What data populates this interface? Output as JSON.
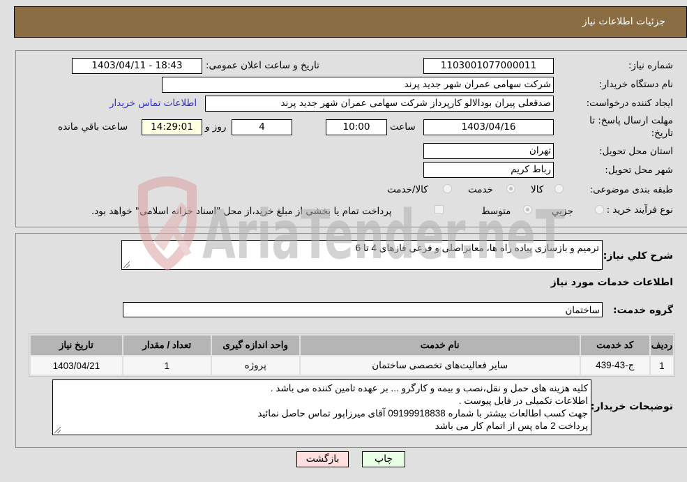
{
  "header": {
    "title": "جزئیات اطلاعات نیاز"
  },
  "details": {
    "need_number": {
      "label": "شماره نیاز:",
      "value": "1103001077000011"
    },
    "announce_datetime": {
      "label": "تاریخ و ساعت اعلان عمومی:",
      "value": "1403/04/11 - 18:43"
    },
    "buyer_org": {
      "label": "نام دستگاه خریدار:",
      "value": "شرکت سهامی عمران شهر جدید پرند"
    },
    "requester": {
      "label": "ایجاد کننده درخواست:",
      "value": "صدقعلی پیران بودالالو کارپرداز شرکت سهامی عمران شهر جدید پرند"
    },
    "buyer_contact_link": "اطلاعات تماس خریدار",
    "deadline": {
      "label": "مهلت ارسال پاسخ: تا تاریخ:",
      "date": "1403/04/16",
      "time_label": "ساعت",
      "time": "10:00",
      "days": "4",
      "days_label": "روز و",
      "remaining": "14:29:01",
      "remaining_label": "ساعت باقي مانده"
    },
    "province": {
      "label": "استان محل تحویل:",
      "value": "تهران"
    },
    "city": {
      "label": "شهر محل تحویل:",
      "value": "رباط کریم"
    },
    "category": {
      "label": "طبقه بندی موضوعی:",
      "options": [
        "کالا",
        "خدمت",
        "کالا/خدمت"
      ],
      "selected": "خدمت"
    },
    "purchase_type": {
      "label": "نوع فرآیند خرید :",
      "options": [
        "جزيي",
        "متوسط"
      ],
      "selected": "متوسط",
      "treasury_note": "پرداخت تمام یا بخشی از مبلغ خرید،از محل \"اسناد خزانه اسلامی\" خواهد بود."
    }
  },
  "description": {
    "label": "شرح کلي نياز:",
    "value": "ترمیم و بازسازی پیاده راه ها، معابراصلی و فرعی فازهای 4 تا 6"
  },
  "services": {
    "section_title": "اطلاعات خدمات مورد نیاز",
    "group_label": "گروه خدمت:",
    "group_value": "ساختمان",
    "columns": [
      "ردیف",
      "کد خدمت",
      "نام خدمت",
      "واحد اندازه گیری",
      "تعداد / مقدار",
      "تاریخ نیاز"
    ],
    "rows": [
      [
        "1",
        "ج-43-439",
        "سایر فعالیت‌های تخصصی ساختمان",
        "پروژه",
        "1",
        "1403/04/21"
      ]
    ]
  },
  "buyer_notes": {
    "label": "توضیحات خریدار:",
    "lines": [
      "کلیه هزینه های حمل و نقل،نصب و بیمه و کارگرو ... بر عهده تامین کننده می باشد .",
      "اطلاعات تکمیلی در فایل پیوست .",
      "جهت کسب اطالعات بیشتر با شماره 09199918838 آقای میرزاپور تماس حاصل نمائید",
      "پرداخت  2 ماه پس از اتمام کار می باشد"
    ]
  },
  "buttons": {
    "print": "چاپ",
    "back": "بازگشت"
  },
  "watermark": {
    "text": "AriaTender.neT"
  }
}
